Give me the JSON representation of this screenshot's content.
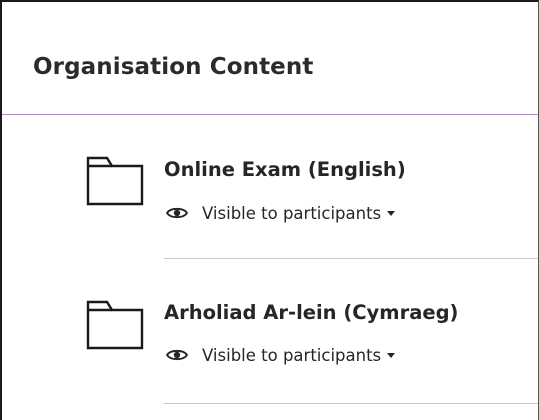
{
  "header": {
    "title": "Organisation Content"
  },
  "items": [
    {
      "title": "Online Exam (English)",
      "visibility": "Visible to participants"
    },
    {
      "title": "Arholiad Ar-lein (Cymraeg)",
      "visibility": "Visible to participants"
    }
  ],
  "icons": {
    "folder": "folder-icon",
    "visibility": "eye-icon",
    "dropdown": "caret-down-icon"
  },
  "colors": {
    "header_divider": "#b58cc8",
    "item_divider": "#c8c8c8",
    "text": "#262626"
  }
}
